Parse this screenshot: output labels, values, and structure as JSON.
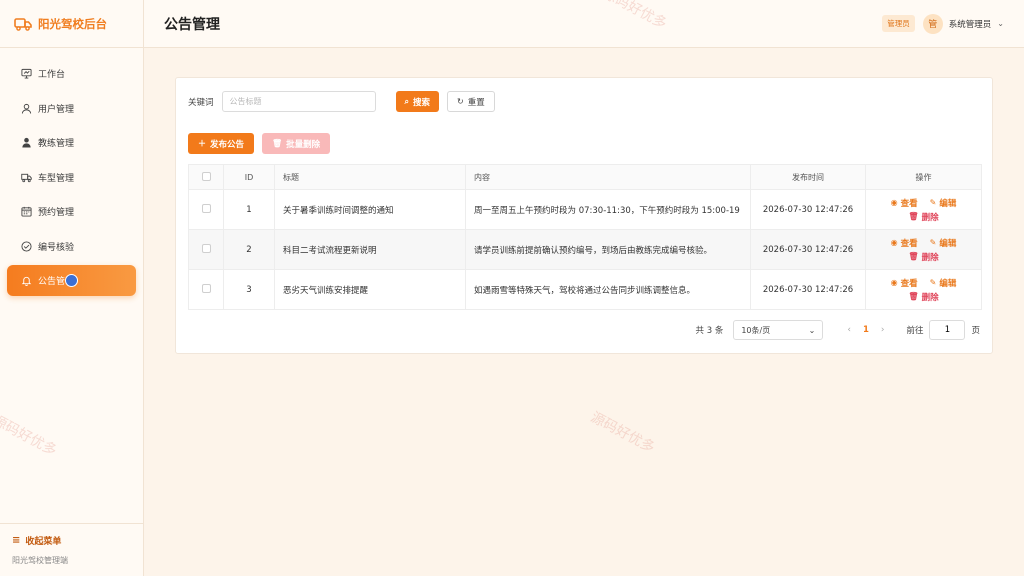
{
  "app": {
    "brand": "阳光驾校后台",
    "footer": "阳光驾校管理端",
    "collapse_label": "收起菜单"
  },
  "sidebar": {
    "items": [
      {
        "label": "工作台",
        "icon": "dashboard-icon",
        "active": false
      },
      {
        "label": "用户管理",
        "icon": "user-icon",
        "active": false
      },
      {
        "label": "教练管理",
        "icon": "coach-icon",
        "active": false
      },
      {
        "label": "车型管理",
        "icon": "truck-icon",
        "active": false
      },
      {
        "label": "预约管理",
        "icon": "calendar-icon",
        "active": false
      },
      {
        "label": "编号核验",
        "icon": "check-circle-icon",
        "active": false
      },
      {
        "label": "公告管",
        "icon": "bell-icon",
        "active": true
      }
    ]
  },
  "header": {
    "title": "公告管理",
    "role": "管理员",
    "avatar_text": "管",
    "username": "系统管理员"
  },
  "filter": {
    "label": "关键词",
    "placeholder": "公告标题",
    "value": "",
    "search_label": "搜索",
    "reset_label": "重置"
  },
  "toolbar": {
    "add_label": "发布公告",
    "batch_delete_label": "批量删除"
  },
  "table": {
    "columns": [
      "ID",
      "标题",
      "内容",
      "发布时间",
      "操作"
    ],
    "rows": [
      {
        "id": "1",
        "title": "关于暑季训练时间调整的通知",
        "content": "周一至周五上午预约时段为 07:30-11:30，下午预约时段为 15:00-19",
        "time": "2026-07-30 12:47:26"
      },
      {
        "id": "2",
        "title": "科目二考试流程更新说明",
        "content": "请学员训练前提前确认预约编号，到场后由教练完成编号核验。",
        "time": "2026-07-30 12:47:26"
      },
      {
        "id": "3",
        "title": "恶劣天气训练安排提醒",
        "content": "如遇雨雪等特殊天气，驾校将通过公告同步训练调整信息。",
        "time": "2026-07-30 12:47:26"
      }
    ],
    "ops": {
      "view": "查看",
      "edit": "编辑",
      "delete": "删除"
    }
  },
  "pagination": {
    "total": "共 3 条",
    "page_size": "10条/页",
    "current": "1",
    "goto_label": "前往",
    "goto_value": "1",
    "unit": "页"
  },
  "watermark": "源码好优多",
  "colors": {
    "accent": "#f27a1a",
    "danger": "#e0455a"
  }
}
